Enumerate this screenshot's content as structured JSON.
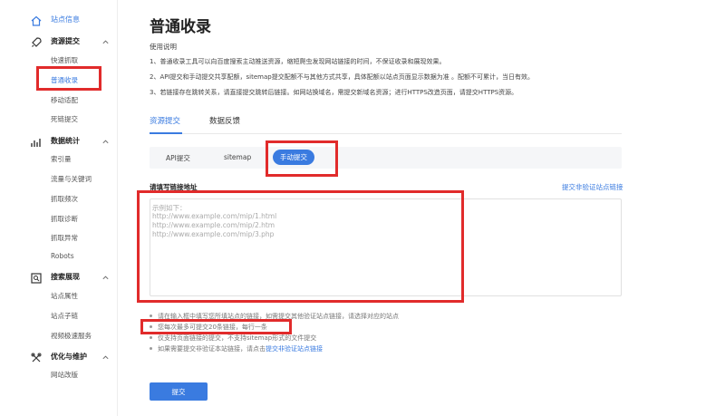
{
  "sidebar": {
    "site_info": "站点信息",
    "resource_submit": {
      "label": "资源提交",
      "items": [
        "快速抓取",
        "普通收录",
        "移动适配",
        "死链提交"
      ]
    },
    "data_stats": {
      "label": "数据统计",
      "items": [
        "索引量",
        "流量与关键词",
        "抓取频次",
        "抓取诊断",
        "抓取异常",
        "Robots"
      ]
    },
    "search_display": {
      "label": "搜索展现",
      "items": [
        "站点属性",
        "站点子链",
        "视频极速服务"
      ]
    },
    "optimize": {
      "label": "优化与维护",
      "items": [
        "网站改版"
      ]
    }
  },
  "main": {
    "title": "普通收录",
    "usage_label": "使用说明",
    "usage_lines": [
      "1、普通收录工具可以向百度搜索主动推送资源，缩短爬虫发现网站链接的时间，不保证收录和展现效果。",
      "2、API提交和手动提交共享配额，sitemap提交配额不与其他方式共享，具体配额以站点页面显示数据为准 。配额不可累计，当日有效。",
      "3、若链接存在跳转关系，请直接提交跳转后链接。如网站换域名，需提交新域名资源；进行HTTPS改造页面，请提交HTTPS资源。"
    ],
    "tabs": [
      "资源提交",
      "数据反馈"
    ],
    "subtabs": [
      "API提交",
      "sitemap",
      "手动提交"
    ],
    "field_label": "请填写链接地址",
    "side_link": "提交非验证站点链接",
    "textarea_placeholder": [
      "示例如下：",
      "http://www.example.com/mip/1.html",
      "http://www.example.com/mip/2.htm",
      "http://www.example.com/mip/3.php"
    ],
    "notes": [
      "请在输入框中填写您所填站点的链接，如需提交其他验证站点链接，请选择对应的站点",
      "您每次最多可提交20条链接，每行一条",
      "仅支持页面链接的提交，不支持sitemap形式的文件提交"
    ],
    "note4_prefix": "如果需要提交非验证本站链接，请点击",
    "note4_link": "提交非验证站点链接",
    "submit_label": "提交"
  },
  "colors": {
    "accent": "#3a7be0",
    "annotation": "#e12b2b"
  }
}
